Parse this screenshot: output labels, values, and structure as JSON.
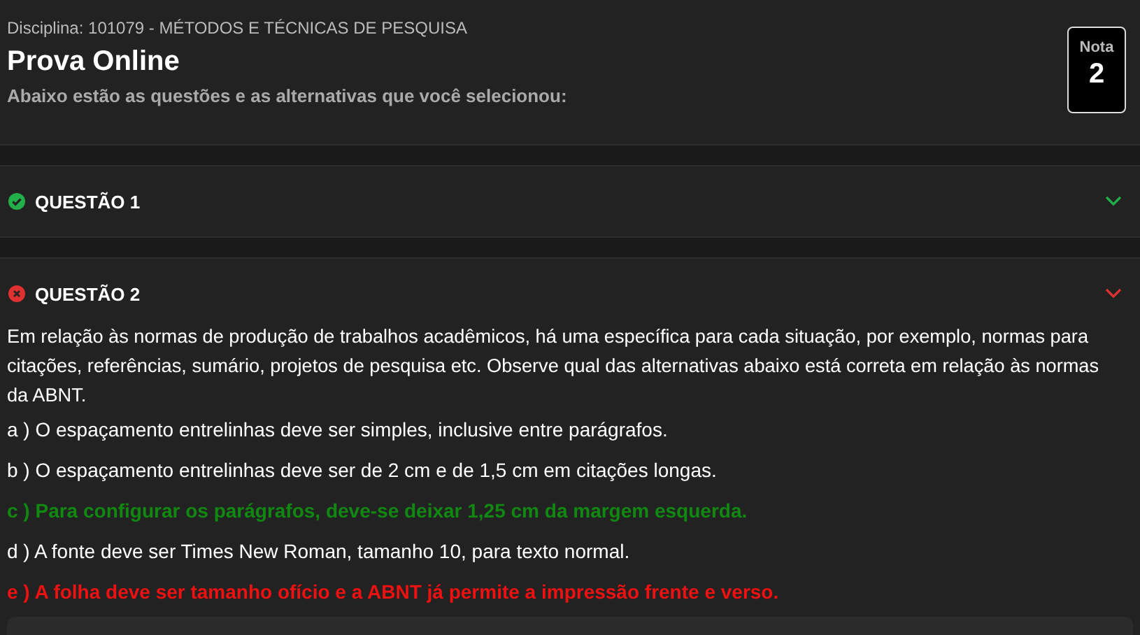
{
  "header": {
    "discipline": "Disciplina: 101079 - MÉTODOS E TÉCNICAS DE PESQUISA",
    "title": "Prova Online",
    "subtitle": "Abaixo estão as questões e as alternativas que você selecionou:",
    "grade": {
      "label": "Nota",
      "value": "2"
    }
  },
  "questions": [
    {
      "title": "QUESTÃO 1",
      "correct": true,
      "expanded": false
    },
    {
      "title": "QUESTÃO 2",
      "correct": false,
      "expanded": true,
      "statement": "Em relação às normas de produção de trabalhos acadêmicos, há uma específica para cada situação, por exemplo, normas para citações, referências, sumário, projetos de pesquisa etc. Observe qual das alternativas abaixo está correta em relação às normas da ABNT.",
      "alternatives": [
        {
          "text": "a ) O espaçamento entrelinhas deve ser simples, inclusive entre parágrafos.",
          "kind": "plain"
        },
        {
          "text": "b ) O espaçamento entrelinhas deve ser de 2 cm e de 1,5 cm em citações longas.",
          "kind": "plain"
        },
        {
          "text": "c ) Para configurar os parágrafos, deve-se deixar 1,25 cm da margem esquerda.",
          "kind": "correct"
        },
        {
          "text": "d ) A fonte deve ser Times New Roman, tamanho 10, para texto normal.",
          "kind": "plain"
        },
        {
          "text": "e ) A folha deve ser tamanho ofício e a ABNT já permite a impressão frente e verso.",
          "kind": "wrong"
        }
      ]
    }
  ]
}
